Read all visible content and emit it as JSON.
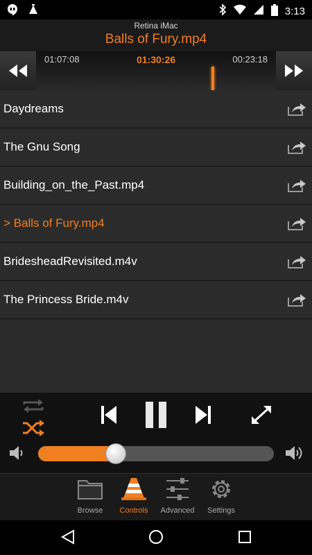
{
  "status_bar": {
    "time": "3:13"
  },
  "header": {
    "device": "Retina iMac",
    "title": "Balls of Fury.mp4"
  },
  "scrubber": {
    "elapsed": "01:07:08",
    "current": "01:30:26",
    "remaining": "00:23:18"
  },
  "playlist": [
    {
      "label": "Daydreams"
    },
    {
      "label": "The Gnu Song"
    },
    {
      "label": "Building_on_the_Past.mp4"
    },
    {
      "label": "> Balls of Fury.mp4"
    },
    {
      "label": "BridesheadRevisited.m4v"
    },
    {
      "label": "The Princess Bride.m4v"
    }
  ],
  "volume": {
    "level": 0.33
  },
  "tabs": [
    {
      "label": "Browse"
    },
    {
      "label": "Controls"
    },
    {
      "label": "Advanced"
    },
    {
      "label": "Settings"
    }
  ],
  "colors": {
    "accent": "#f07f22",
    "list_bg": "#2b2b2b"
  }
}
